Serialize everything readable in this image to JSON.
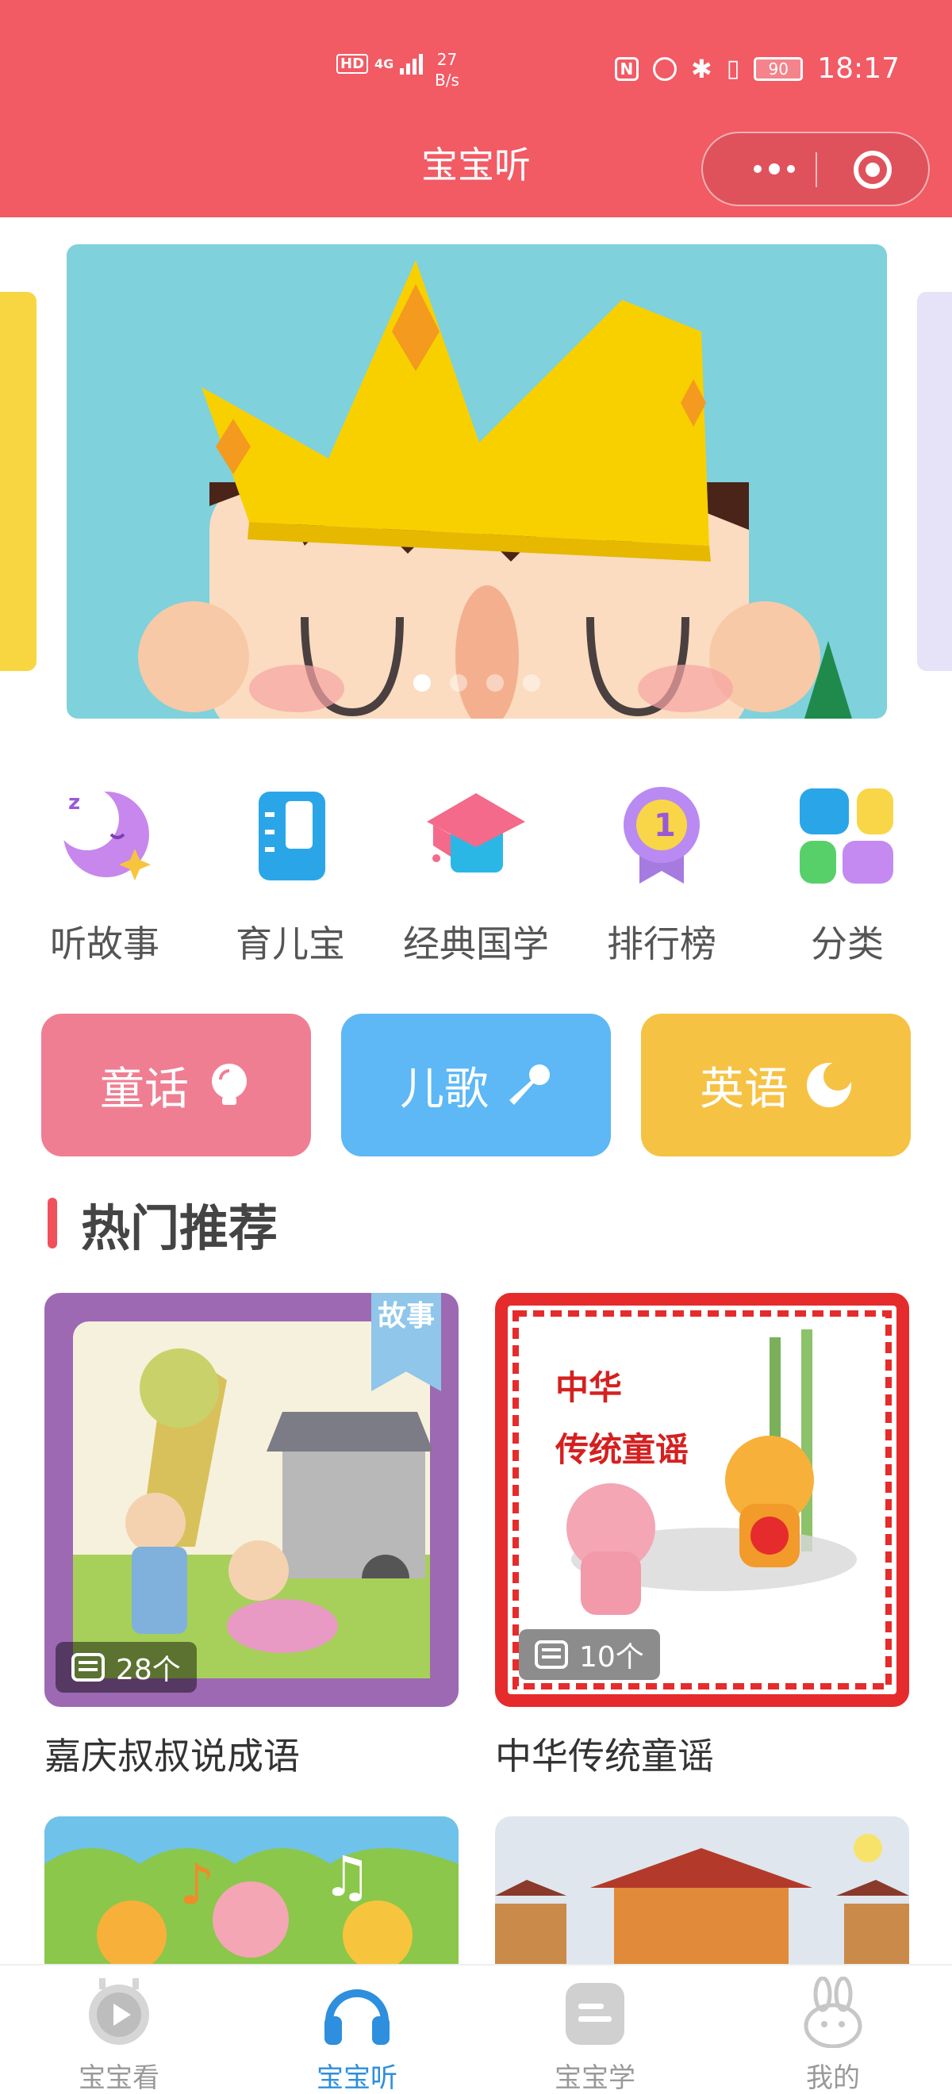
{
  "status_bar": {
    "network": "4G",
    "hd": "HD",
    "speed_value": "27",
    "speed_unit": "B/s",
    "nfc": "N",
    "battery": "90",
    "time": "18:17"
  },
  "header": {
    "title": "宝宝听",
    "accent_color": "#f25a64"
  },
  "banner": {
    "slide_count": 4,
    "active_index": 0
  },
  "quick_nav": [
    {
      "label": "听故事",
      "icon": "moon-star-icon"
    },
    {
      "label": "育儿宝",
      "icon": "notebook-icon"
    },
    {
      "label": "经典国学",
      "icon": "graduation-cap-icon"
    },
    {
      "label": "排行榜",
      "icon": "medal-icon"
    },
    {
      "label": "分类",
      "icon": "category-grid-icon"
    }
  ],
  "category_pills": [
    {
      "label": "童话",
      "icon": "lightbulb-icon",
      "color": "#f07e92"
    },
    {
      "label": "儿歌",
      "icon": "microphone-icon",
      "color": "#5db8f5"
    },
    {
      "label": "英语",
      "icon": "moon-icon",
      "color": "#f6c244"
    }
  ],
  "section": {
    "title": "热门推荐"
  },
  "cards": [
    {
      "title": "嘉庆叔叔说成语",
      "count": "28个",
      "tag": "故事"
    },
    {
      "title": "中华传统童谣",
      "count": "10个",
      "cover_text_1": "中华",
      "cover_text_2": "传统童谣"
    }
  ],
  "tabs": [
    {
      "label": "宝宝看",
      "icon": "play-tv-icon",
      "active": false
    },
    {
      "label": "宝宝听",
      "icon": "headphones-icon",
      "active": true
    },
    {
      "label": "宝宝学",
      "icon": "book-icon",
      "active": false
    },
    {
      "label": "我的",
      "icon": "rabbit-icon",
      "active": false
    }
  ]
}
